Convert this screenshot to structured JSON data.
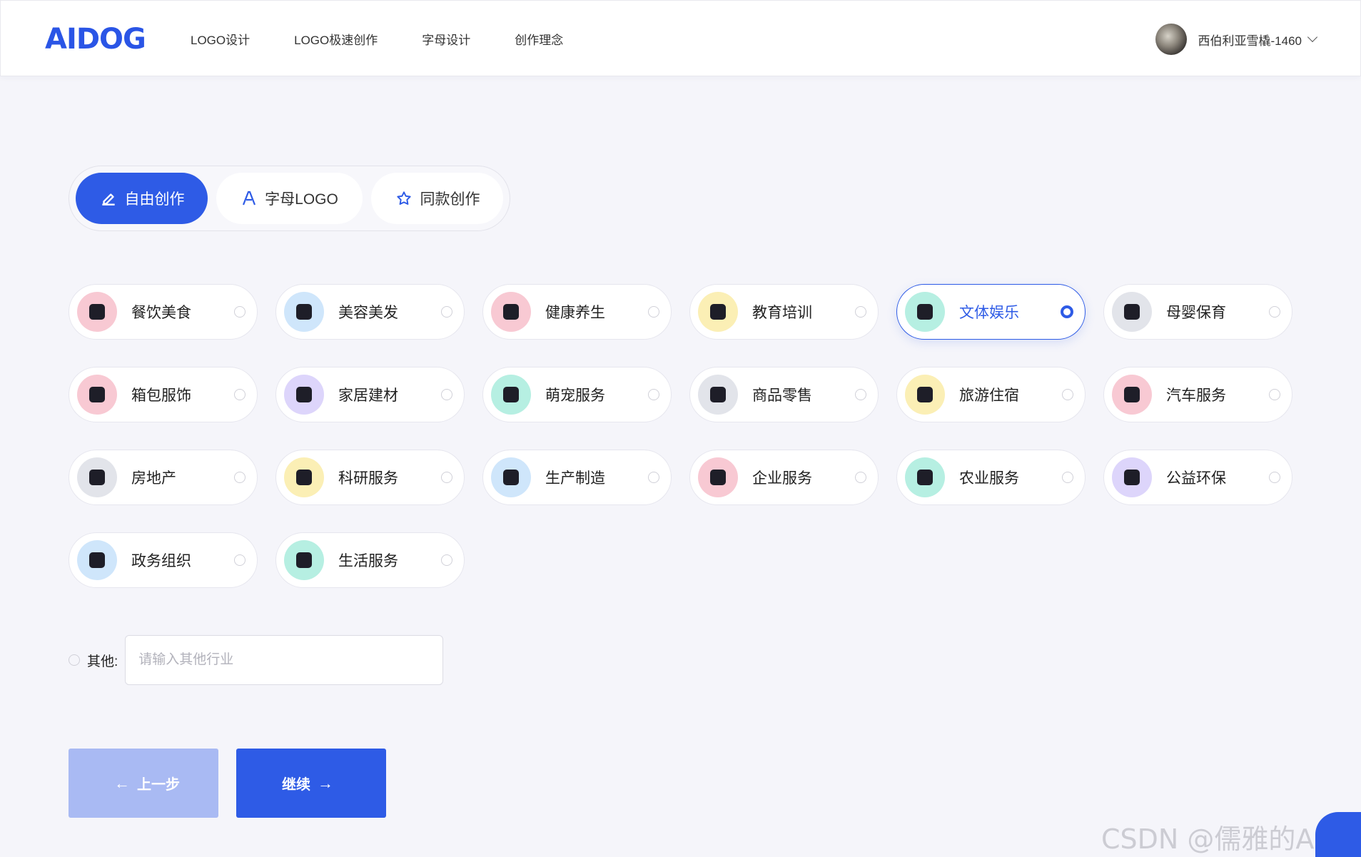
{
  "header": {
    "logo_text": "AIDOG",
    "nav": [
      "LOGO设计",
      "LOGO极速创作",
      "字母设计",
      "创作理念"
    ],
    "user_name": "西伯利亚雪橇-1460"
  },
  "mode_tabs": [
    {
      "label": "自由创作",
      "icon": "pen-edit-icon",
      "active": true
    },
    {
      "label": "字母LOGO",
      "icon": "letter-a-icon",
      "active": false
    },
    {
      "label": "同款创作",
      "icon": "sparkle-star-icon",
      "active": false
    }
  ],
  "industries": [
    {
      "label": "餐饮美食",
      "icon": "food-cloche-icon",
      "color": "#f8c9d3",
      "selected": false
    },
    {
      "label": "美容美发",
      "icon": "beauty-face-icon",
      "color": "#cfe6fb",
      "selected": false
    },
    {
      "label": "健康养生",
      "icon": "teapot-icon",
      "color": "#f8c9d3",
      "selected": false
    },
    {
      "label": "教育培训",
      "icon": "graduation-cap-icon",
      "color": "#fbefb5",
      "selected": false
    },
    {
      "label": "文体娱乐",
      "icon": "basketball-icon",
      "color": "#b6efe2",
      "selected": true
    },
    {
      "label": "母婴保育",
      "icon": "mother-baby-icon",
      "color": "#e2e4ea",
      "selected": false
    },
    {
      "label": "箱包服饰",
      "icon": "shopping-bag-icon",
      "color": "#f8c9d3",
      "selected": false
    },
    {
      "label": "家居建材",
      "icon": "bricks-icon",
      "color": "#ddd5fb",
      "selected": false
    },
    {
      "label": "萌宠服务",
      "icon": "paw-icon",
      "color": "#b6efe2",
      "selected": false
    },
    {
      "label": "商品零售",
      "icon": "store-icon",
      "color": "#e2e4ea",
      "selected": false
    },
    {
      "label": "旅游住宿",
      "icon": "hotel-icon",
      "color": "#fbefb5",
      "selected": false
    },
    {
      "label": "汽车服务",
      "icon": "car-icon",
      "color": "#f8c9d3",
      "selected": false
    },
    {
      "label": "房地产",
      "icon": "building-icon",
      "color": "#e2e4ea",
      "selected": false
    },
    {
      "label": "科研服务",
      "icon": "microscope-icon",
      "color": "#fbefb5",
      "selected": false
    },
    {
      "label": "生产制造",
      "icon": "gear-wrench-icon",
      "color": "#cfe6fb",
      "selected": false
    },
    {
      "label": "企业服务",
      "icon": "briefcase-icon",
      "color": "#f8c9d3",
      "selected": false
    },
    {
      "label": "农业服务",
      "icon": "leaf-icon",
      "color": "#b6efe2",
      "selected": false
    },
    {
      "label": "公益环保",
      "icon": "heart-hand-icon",
      "color": "#ddd5fb",
      "selected": false
    },
    {
      "label": "政务组织",
      "icon": "flag-document-icon",
      "color": "#cfe6fb",
      "selected": false
    },
    {
      "label": "生活服务",
      "icon": "flower-icon",
      "color": "#b6efe2",
      "selected": false
    }
  ],
  "other": {
    "label": "其他:",
    "placeholder": "请输入其他行业"
  },
  "buttons": {
    "prev": "上一步",
    "next": "继续"
  },
  "watermark": "CSDN @儒雅的AIDOG"
}
